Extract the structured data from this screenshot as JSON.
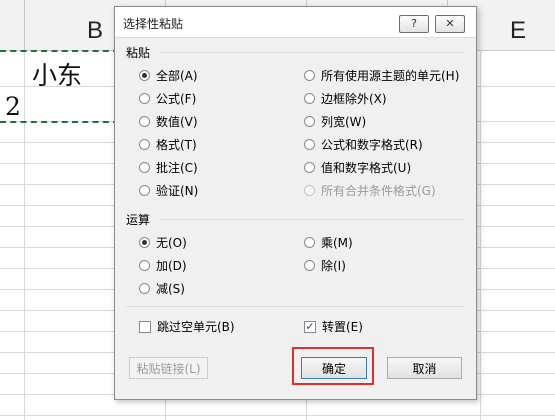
{
  "sheet": {
    "columns": [
      "B",
      "E"
    ],
    "cells": {
      "b1": "小东",
      "a2_fragment": "2"
    }
  },
  "dialog": {
    "title": "选择性粘贴",
    "help_label": "?",
    "close_label": "✕",
    "paste_group": {
      "label": "粘贴",
      "left_options": [
        {
          "label": "全部(A)",
          "selected": true
        },
        {
          "label": "公式(F)",
          "selected": false
        },
        {
          "label": "数值(V)",
          "selected": false
        },
        {
          "label": "格式(T)",
          "selected": false
        },
        {
          "label": "批注(C)",
          "selected": false
        },
        {
          "label": "验证(N)",
          "selected": false
        }
      ],
      "right_options": [
        {
          "label": "所有使用源主题的单元(H)",
          "selected": false,
          "disabled": false
        },
        {
          "label": "边框除外(X)",
          "selected": false,
          "disabled": false
        },
        {
          "label": "列宽(W)",
          "selected": false,
          "disabled": false
        },
        {
          "label": "公式和数字格式(R)",
          "selected": false,
          "disabled": false
        },
        {
          "label": "值和数字格式(U)",
          "selected": false,
          "disabled": false
        },
        {
          "label": "所有合并条件格式(G)",
          "selected": false,
          "disabled": true
        }
      ]
    },
    "operation_group": {
      "label": "运算",
      "left_options": [
        {
          "label": "无(O)",
          "selected": true
        },
        {
          "label": "加(D)",
          "selected": false
        },
        {
          "label": "减(S)",
          "selected": false
        }
      ],
      "right_options": [
        {
          "label": "乘(M)",
          "selected": false
        },
        {
          "label": "除(I)",
          "selected": false
        }
      ]
    },
    "skip_blanks": {
      "label": "跳过空单元(B)",
      "checked": false
    },
    "transpose": {
      "label": "转置(E)",
      "checked": true,
      "check_glyph": "✓"
    },
    "buttons": {
      "paste_link": "粘贴链接(L)",
      "ok": "确定",
      "cancel": "取消"
    },
    "accent_colors": {
      "highlight": "#e0302a",
      "copy_marquee": "#1f6f3f"
    }
  }
}
